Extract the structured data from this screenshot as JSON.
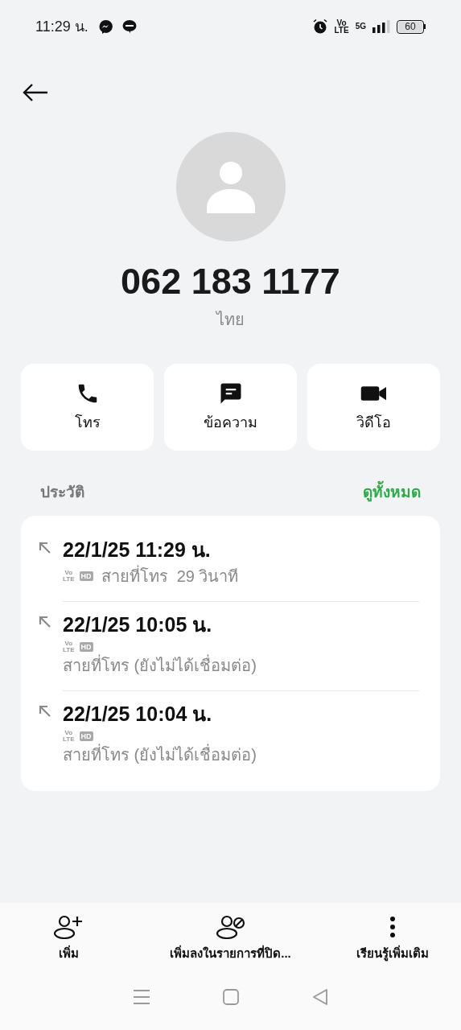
{
  "status_bar": {
    "time": "11:29 น.",
    "network": [
      "Vo",
      "LTE"
    ],
    "data_label": "5G",
    "battery": "60"
  },
  "contact": {
    "number": "062 183 1177",
    "location": "ไทย"
  },
  "actions": [
    {
      "kind": "call",
      "label": "โทร"
    },
    {
      "kind": "message",
      "label": "ข้อความ"
    },
    {
      "kind": "video",
      "label": "วิดีโอ"
    }
  ],
  "history": {
    "title": "ประวัติ",
    "link": "ดูทั้งหมด",
    "calls": [
      {
        "kind": "inline",
        "datetime": "22/1/25 11:29 น.",
        "network": [
          "Vo",
          "LTE"
        ],
        "hd": "HD",
        "detail": "สายที่โทร  29 วินาที"
      },
      {
        "kind": "stacked",
        "datetime": "22/1/25 10:05 น.",
        "network": [
          "Vo",
          "LTE"
        ],
        "hd": "HD",
        "detail": "สายที่โทร (ยังไม่ได้เชื่อมต่อ)"
      },
      {
        "kind": "stacked",
        "datetime": "22/1/25 10:04 น.",
        "network": [
          "Vo",
          "LTE"
        ],
        "hd": "HD",
        "detail": "สายที่โทร (ยังไม่ได้เชื่อมต่อ)"
      }
    ]
  },
  "bottom_actions": [
    {
      "kind": "add",
      "label": "เพิ่ม"
    },
    {
      "kind": "block",
      "label": "เพิ่มลงในรายการที่ปิด..."
    },
    {
      "kind": "more",
      "label": "เรียนรู้เพิ่มเติม"
    }
  ]
}
